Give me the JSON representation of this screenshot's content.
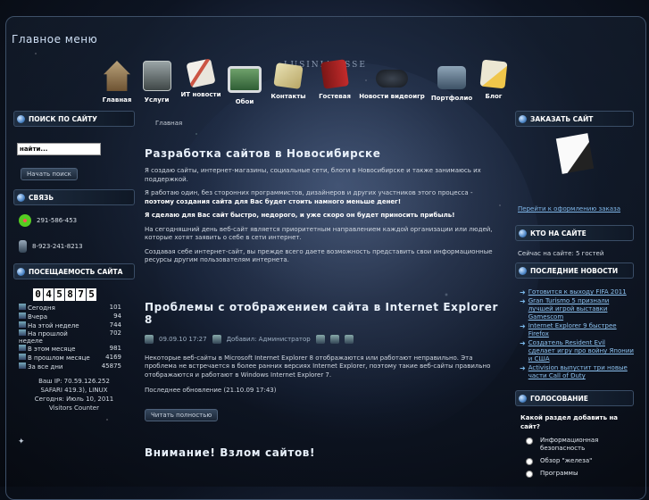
{
  "header": {
    "main_menu": "Главное меню",
    "brand": "LUSINIA ESSE"
  },
  "nav": [
    {
      "label": "Главная",
      "icon": "home-icon"
    },
    {
      "label": "Услуги",
      "icon": "safe-icon"
    },
    {
      "label": "ИТ новости",
      "icon": "papers-icon"
    },
    {
      "label": "Обои",
      "icon": "monitor-icon"
    },
    {
      "label": "Контакты",
      "icon": "mail-icon"
    },
    {
      "label": "Гостевая",
      "icon": "book-icon"
    },
    {
      "label": "Новости видеоигр",
      "icon": "gamepad-icon"
    },
    {
      "label": "Портфолио",
      "icon": "briefcase-icon"
    },
    {
      "label": "Блог",
      "icon": "pencil-icon"
    }
  ],
  "left": {
    "search_title": "ПОИСК ПО САЙТУ",
    "search_placeholder": "найти...",
    "search_button": "Начать поиск",
    "contact_title": "СВЯЗЬ",
    "icq": "291-586-453",
    "phone": "8-923-241-8213",
    "stats_title": "ПОСЕЩАЕМОСТЬ САЙТА",
    "counter": [
      "0",
      "4",
      "5",
      "8",
      "7",
      "5"
    ],
    "stats": [
      {
        "label": "Сегодня",
        "value": "101"
      },
      {
        "label": "Вчера",
        "value": "94"
      },
      {
        "label": "На этой неделе",
        "value": "744"
      },
      {
        "label": "На прошлой неделе",
        "value": "702"
      },
      {
        "label": "В этом месяце",
        "value": "981"
      },
      {
        "label": "В прошлом месяце",
        "value": "4169"
      },
      {
        "label": "За все дни",
        "value": "45875"
      }
    ],
    "info_ip": "Ваш IP: 70.59.126.252",
    "info_browser": "SAFARI 419.3), LINUX",
    "info_date": "Сегодня: Июль 10, 2011",
    "info_counter": "Visitors Counter"
  },
  "content": {
    "breadcrumb": "Главная",
    "post1": {
      "title": "Разработка сайтов в Новосибирске",
      "p1": "Я создаю сайты, интернет-магазины, социальные сети, блоги в Новосибирске и также занимаюсь их поддержкой.",
      "p2a": "Я работаю один, без сторонних программистов, дизайнеров и других участников этого процесса - ",
      "p2b": "поэтому создания сайта для Вас будет стоить намного меньше денег!",
      "p3": "Я сделаю для Вас сайт быстро, недорого, и уже скоро он будет приносить прибыль!",
      "p4": "На сегодняшний день веб-сайт является приоритетным направлением каждой организации или людей, которые хотят заявить о себе в сети интернет.",
      "p5": "Создавая себе интернет-сайт, вы прежде всего даете возможность представить свои информационные ресурсы другим пользователям интернета."
    },
    "post2": {
      "title": "Проблемы с отображением сайта в Internet Explorer 8",
      "date": "09.09.10 17:27",
      "author": "Добавил: Администратор",
      "text": "Некоторые веб-сайты в Microsoft Internet Explorer 8 отображаются или работают неправильно. Эта проблема не встречается в более ранних версиях Internet Explorer, поэтому такие веб-сайты правильно отображаются и работают в Windows Internet Explorer 7.",
      "updated": "Последнее обновление (21.10.09 17:43)",
      "read_more": "Читать полностью"
    },
    "post3": {
      "title": "Внимание! Взлом сайтов!"
    }
  },
  "right": {
    "order_title": "ЗАКАЗАТЬ САЙТ",
    "order_link": "Перейти к оформлению заказа",
    "online_title": "КТО НА САЙТЕ",
    "online_text": "Сейчас на сайте: 5 гостей",
    "news_title": "ПОСЛЕДНИЕ НОВОСТИ",
    "news": [
      "Готовится к выходу FIFA 2011",
      "Gran Turismo 5 признали лучшей игрой выставки Gamescom",
      "Internet Explorer 9 быстрее Firefox",
      "Создатель Resident Evil сделает игру про войну Японии и США",
      "Activision выпустит три новые части Call of Duty"
    ],
    "poll_title": "ГОЛОСОВАНИЕ",
    "poll_question": "Какой раздел добавить на сайт?",
    "poll_options": [
      "Информационная безопасность",
      "Обзор \"железа\"",
      "Программы"
    ]
  }
}
